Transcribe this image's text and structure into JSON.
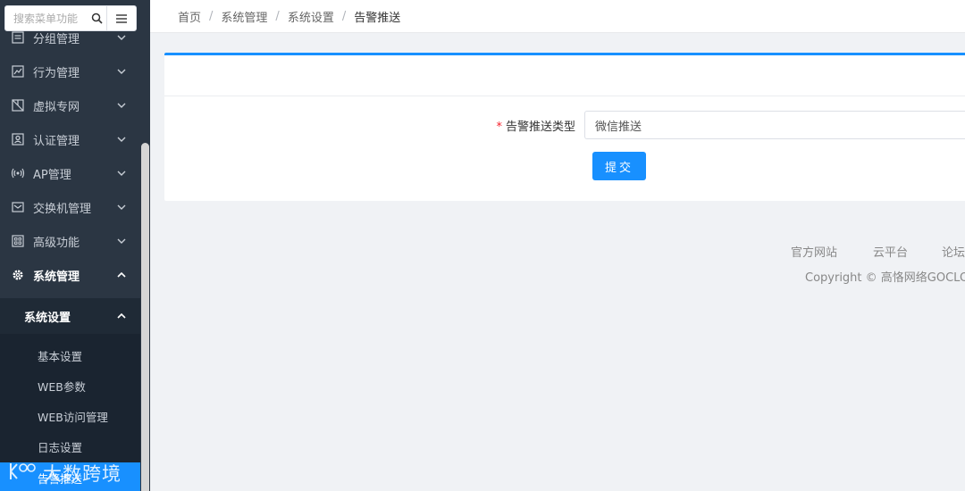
{
  "sidebar": {
    "search_placeholder": "搜索菜单功能",
    "items": [
      {
        "label": "分组管理",
        "icon": "group-icon"
      },
      {
        "label": "行为管理",
        "icon": "chart-line-icon"
      },
      {
        "label": "虚拟专网",
        "icon": "vpn-icon"
      },
      {
        "label": "认证管理",
        "icon": "user-badge-icon"
      },
      {
        "label": "AP管理",
        "icon": "wireless-icon"
      },
      {
        "label": "交换机管理",
        "icon": "switch-icon"
      },
      {
        "label": "高级功能",
        "icon": "grid-icon"
      },
      {
        "label": "系统管理",
        "icon": "gear-icon"
      }
    ],
    "submenu_title": "系统设置",
    "sub_items": [
      "基本设置",
      "WEB参数",
      "WEB访问管理",
      "日志设置",
      "告警推送"
    ],
    "selected_sub_item": "告警推送"
  },
  "breadcrumb": [
    "首页",
    "系统管理",
    "系统设置",
    "告警推送"
  ],
  "form": {
    "label": "告警推送类型",
    "value": "微信推送",
    "submit_label": "提交"
  },
  "footer": {
    "links": [
      "官方网站",
      "云平台",
      "论坛"
    ],
    "copyright": "Copyright © 高恪网络GOCLOUD"
  },
  "watermark": "大数跨境",
  "colors": {
    "accent": "#1890ff",
    "sidebar_bg": "#2b3643",
    "required": "#f5222d"
  }
}
